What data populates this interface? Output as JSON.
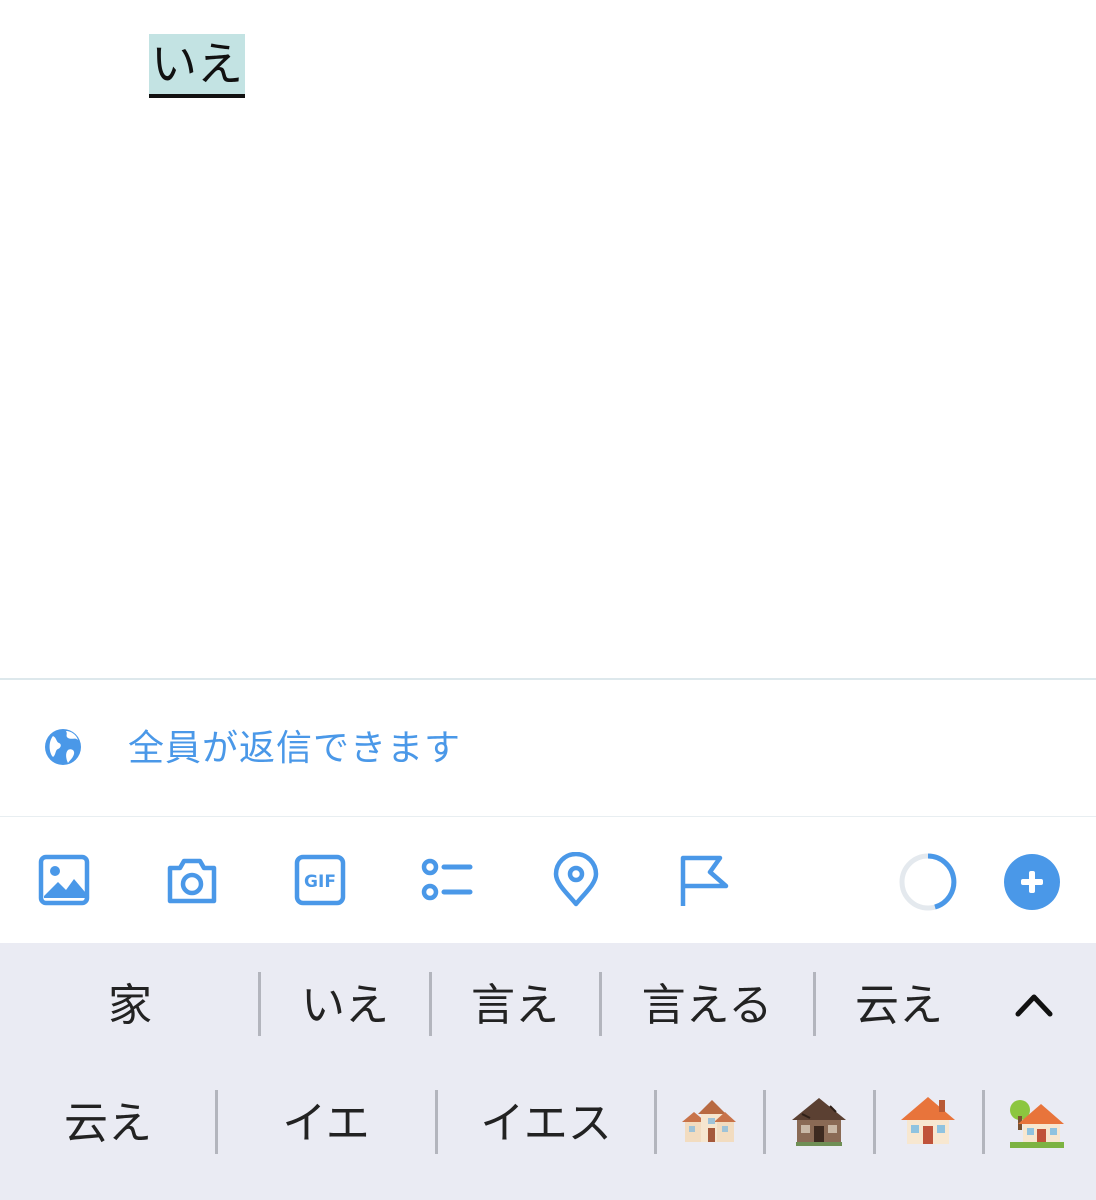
{
  "compose": {
    "text": "いえ"
  },
  "reply_setting": {
    "label": "全員が返信できます",
    "icon": "globe-icon"
  },
  "toolbar": {
    "icons": [
      "image-icon",
      "camera-icon",
      "gif-icon",
      "poll-icon",
      "location-icon",
      "flag-icon"
    ],
    "counter_icon": "character-counter-ring",
    "add_icon": "plus-icon",
    "accent_color": "#4a98e8"
  },
  "keyboard": {
    "row1": [
      "家",
      "いえ",
      "言え",
      "言える",
      "云え"
    ],
    "row2": [
      "云え",
      "イエ",
      "イエス"
    ],
    "emoji": [
      "houses-emoji",
      "derelict-house-emoji",
      "house-emoji",
      "house-with-garden-emoji"
    ],
    "expand_icon": "chevron-up-icon"
  }
}
